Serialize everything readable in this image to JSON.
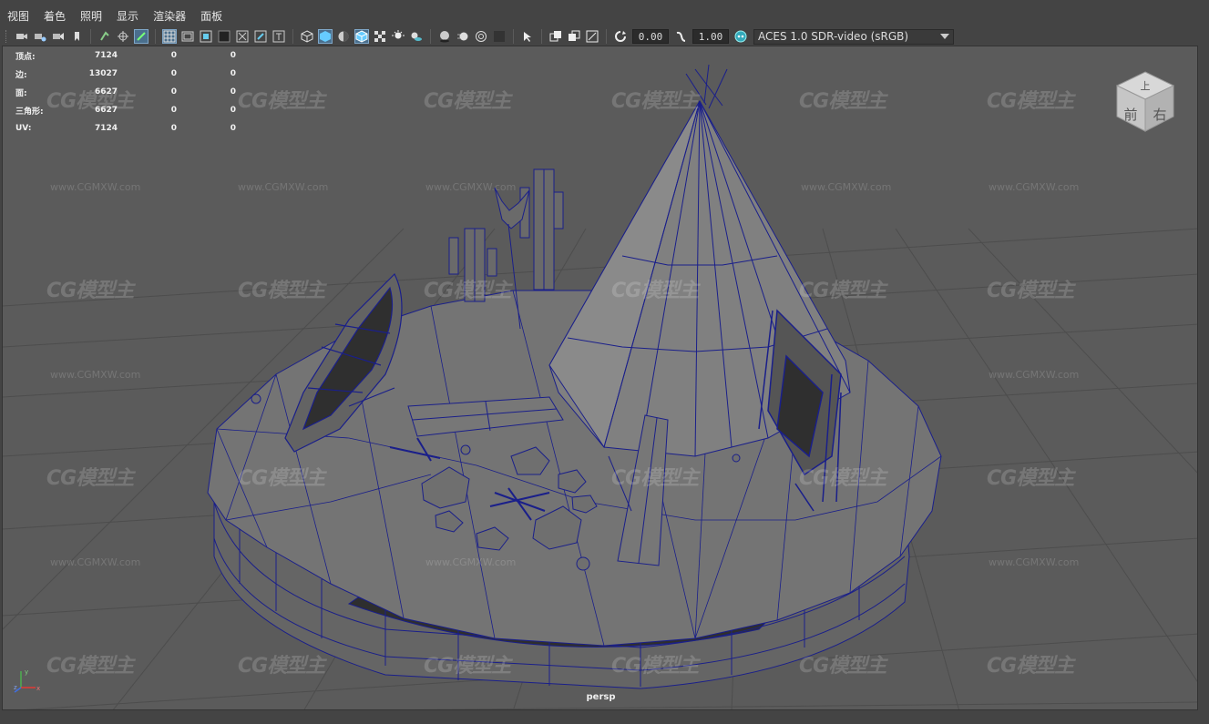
{
  "menu": [
    "视图",
    "着色",
    "照明",
    "显示",
    "渲染器",
    "面板"
  ],
  "toolbar": {
    "icons": [
      "camera-select-icon",
      "camera-attributes-icon",
      "bookmark-icon",
      "image-plane-icon",
      "grid-icon",
      "film-gate-icon",
      "resolution-gate-icon",
      "gate-mask-icon",
      "field-chart-icon",
      "safe-action-icon",
      "safe-title-icon",
      "wireframe-icon",
      "smooth-shade-icon",
      "default-material-icon",
      "wireframe-on-shaded-icon",
      "textured-icon",
      "lights-icon",
      "shadows-icon",
      "screen-space-ao-icon",
      "motion-blur-icon",
      "multisample-aa-icon",
      "depth-of-field-icon",
      "isolate-select-icon",
      "xray-icon",
      "xray-active-icon",
      "xray-joints-icon",
      "backface-culling-icon",
      "exposure-icon",
      "gamma-icon",
      "color-management-icon"
    ],
    "exposure_value": "0.00",
    "gamma_value": "1.00",
    "colorspace": "ACES 1.0 SDR-video (sRGB)"
  },
  "hud": {
    "rows": [
      {
        "label": "顶点:",
        "v1": "7124",
        "v2": "0",
        "v3": "0"
      },
      {
        "label": "边:",
        "v1": "13027",
        "v2": "0",
        "v3": "0"
      },
      {
        "label": "面:",
        "v1": "6627",
        "v2": "0",
        "v3": "0"
      },
      {
        "label": "三角形:",
        "v1": "6627",
        "v2": "0",
        "v3": "0"
      },
      {
        "label": "UV:",
        "v1": "7124",
        "v2": "0",
        "v3": "0"
      }
    ]
  },
  "viewcube": {
    "top": "上",
    "front": "前",
    "right": "右"
  },
  "camera_label": "persp",
  "watermark": {
    "logo": "CG模型主",
    "url": "www.CGMXW.com"
  },
  "colors": {
    "wire": "#1a1f8a",
    "grid": "#4a4a4a",
    "viewport_bg": "#5b5b5b",
    "mesh_face": "#6d6d6d",
    "active_button": "#4a6f8d"
  }
}
